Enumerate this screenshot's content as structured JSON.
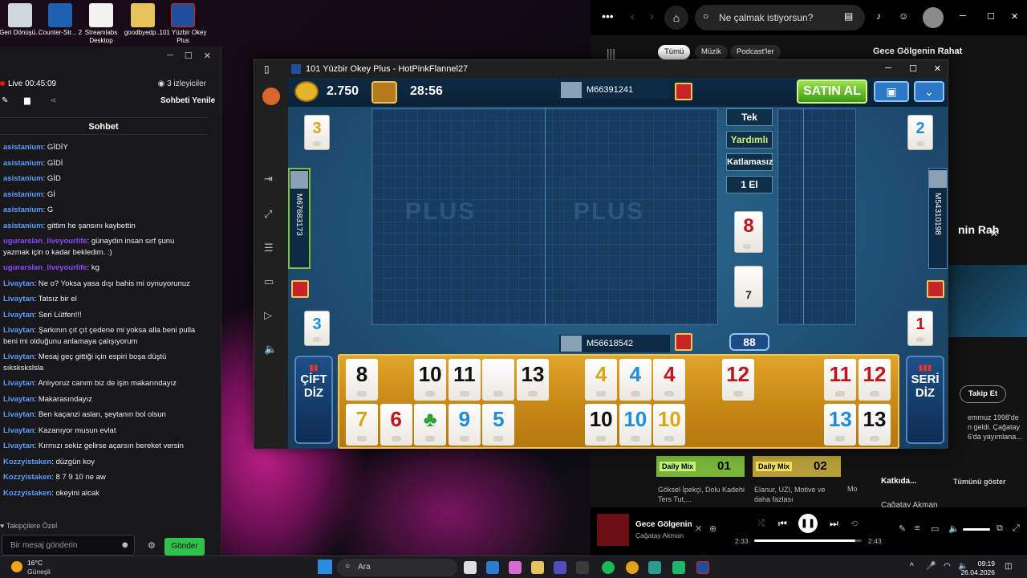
{
  "desktop": {
    "icons": [
      {
        "label": "Geri Dönüşü..."
      },
      {
        "label": "Counter-Str... 2"
      },
      {
        "label": "Streamlabs Desktop"
      },
      {
        "label": "goodbyedp..."
      },
      {
        "label": "101 Yüzbir Okey Plus"
      }
    ]
  },
  "chat": {
    "live_label": "Live",
    "live_time": "00:45:09",
    "viewers": "3 izleyiciler",
    "refresh": "Sohbeti Yenile",
    "header": "Sohbet",
    "messages": [
      {
        "user": "asistanium",
        "text": "GİDİY"
      },
      {
        "user": "asistanium",
        "text": "GİDİ"
      },
      {
        "user": "asistanium",
        "text": "GİD"
      },
      {
        "user": "asistanium",
        "text": "Gİ"
      },
      {
        "user": "asistanium",
        "text": "G"
      },
      {
        "user": "asistanium",
        "text": "gittim he şansını kaybettin"
      },
      {
        "user": "ugurarslan_liveyourlife",
        "text": "günaydın insan sırf şunu yazmak için o kadar bekledim. :)"
      },
      {
        "user": "ugurarslan_liveyourlife",
        "text": "kg"
      },
      {
        "user": "Livaytan",
        "text": "Ne o? Yoksa yasa dışı bahis mi oynuyorunuz"
      },
      {
        "user": "Livaytan",
        "text": "Tatsız bir el"
      },
      {
        "user": "Livaytan",
        "text": "Seri Lütfen!!!"
      },
      {
        "user": "Livaytan",
        "text": "Şarkının çıt çıt çedene mi yoksa alla beni pulla beni mi olduğunu anlamaya çalışıyorum"
      },
      {
        "user": "Livaytan",
        "text": "Mesaj geç gittiği için espiri boşa düştü sıkskskslsla"
      },
      {
        "user": "Livaytan",
        "text": "Anlıyoruz canım biz de işin makarındayız"
      },
      {
        "user": "Livaytan",
        "text": "Makarasındayız"
      },
      {
        "user": "Livaytan",
        "text": "Ben kaçanzi aslan, şeytanın bol olsun"
      },
      {
        "user": "Livaytan",
        "text": "Kazanıyor musun evlat"
      },
      {
        "user": "Livaytan",
        "text": "Kırmızı sekiz gelirse açarsın bereket versin"
      },
      {
        "user": "Kozzyistaken",
        "text": "düzgün koy"
      },
      {
        "user": "Kozzyistaken",
        "text": "8 7 9 10 ne aw"
      },
      {
        "user": "Kozzyistaken",
        "text": "okeyini alcak"
      }
    ],
    "followers_only": "Takipçilere Özel",
    "input_placeholder": "Bir mesaj gönderin",
    "send": "Gönder"
  },
  "spotify": {
    "search_placeholder": "Ne çalmak istiyorsun?",
    "chips": [
      "Tümü",
      "Müzik",
      "Podcast'ler"
    ],
    "right_title": "Gece Gölgenin Rahat",
    "right_title2": "nin Rah",
    "follow": "Takip Et",
    "about_lines": [
      "emmuz 1998'de",
      "n geldi. Çağatay",
      "6'da yayımlana..."
    ],
    "mix1_badge": "Daily Mix",
    "mix1_num": "01",
    "mix1_text": "Göksel İpekçi, Dolu Kadehi Ters Tut,...",
    "mix2_badge": "Daily Mix",
    "mix2_num": "02",
    "mix2_text": "Elanur, UZI, Motive ve daha fazlası",
    "mix3_text": "Mo",
    "contrib": "Katkıda...",
    "show_all": "Tümünü göster",
    "contrib2": "Çağatay Akman",
    "now_playing": "Gece Gölgenin",
    "artist": "Çağatay Akman",
    "elapsed": "2:33",
    "duration": "2:43"
  },
  "game": {
    "title": "101 Yüzbir Okey Plus - HotPinkFlannel27",
    "coins": "2.750",
    "timer": "28:56",
    "buy": "SATIN AL",
    "players": {
      "top": "M66391241",
      "left": "M67683173",
      "right": "M54310198",
      "bottom": "M56618542"
    },
    "options": [
      "Tek",
      "Yardımlı",
      "Katlamasız",
      "1 El"
    ],
    "indicator_tile": "8",
    "deck_count": "7",
    "remaining": "88",
    "corner_tiles": {
      "tl": "3",
      "tr": "2",
      "bl": "3",
      "br": "1"
    },
    "left_btn": [
      "ÇİFT",
      "DİZ"
    ],
    "right_btn": [
      "SERİ",
      "DİZ"
    ],
    "rack_top": [
      {
        "v": "8",
        "c": "blk"
      },
      {
        "v": "",
        "c": "gap"
      },
      {
        "v": "10",
        "c": "blk"
      },
      {
        "v": "11",
        "c": "blk"
      },
      {
        "v": "",
        "c": "blank"
      },
      {
        "v": "13",
        "c": "blk"
      },
      {
        "v": "",
        "c": "gap"
      },
      {
        "v": "4",
        "c": "yel"
      },
      {
        "v": "4",
        "c": "blu"
      },
      {
        "v": "4",
        "c": "red"
      },
      {
        "v": "",
        "c": "gap"
      },
      {
        "v": "12",
        "c": "red"
      },
      {
        "v": "",
        "c": "gap"
      },
      {
        "v": "",
        "c": "gap"
      },
      {
        "v": "11",
        "c": "red"
      },
      {
        "v": "12",
        "c": "red"
      }
    ],
    "rack_bottom": [
      {
        "v": "7",
        "c": "yel"
      },
      {
        "v": "6",
        "c": "red"
      },
      {
        "v": "♣",
        "c": "grn"
      },
      {
        "v": "9",
        "c": "blu"
      },
      {
        "v": "5",
        "c": "blu"
      },
      {
        "v": "",
        "c": "gap"
      },
      {
        "v": "",
        "c": "gap"
      },
      {
        "v": "10",
        "c": "blk"
      },
      {
        "v": "10",
        "c": "blu"
      },
      {
        "v": "10",
        "c": "yel"
      },
      {
        "v": "",
        "c": "gap"
      },
      {
        "v": "",
        "c": "gap"
      },
      {
        "v": "",
        "c": "gap"
      },
      {
        "v": "",
        "c": "gap"
      },
      {
        "v": "13",
        "c": "blu"
      },
      {
        "v": "13",
        "c": "blk"
      }
    ]
  },
  "taskbar": {
    "weather_temp": "16°C",
    "weather_text": "Güneşli",
    "search": "Ara",
    "time": "09:19",
    "date": "26.04.2026"
  }
}
